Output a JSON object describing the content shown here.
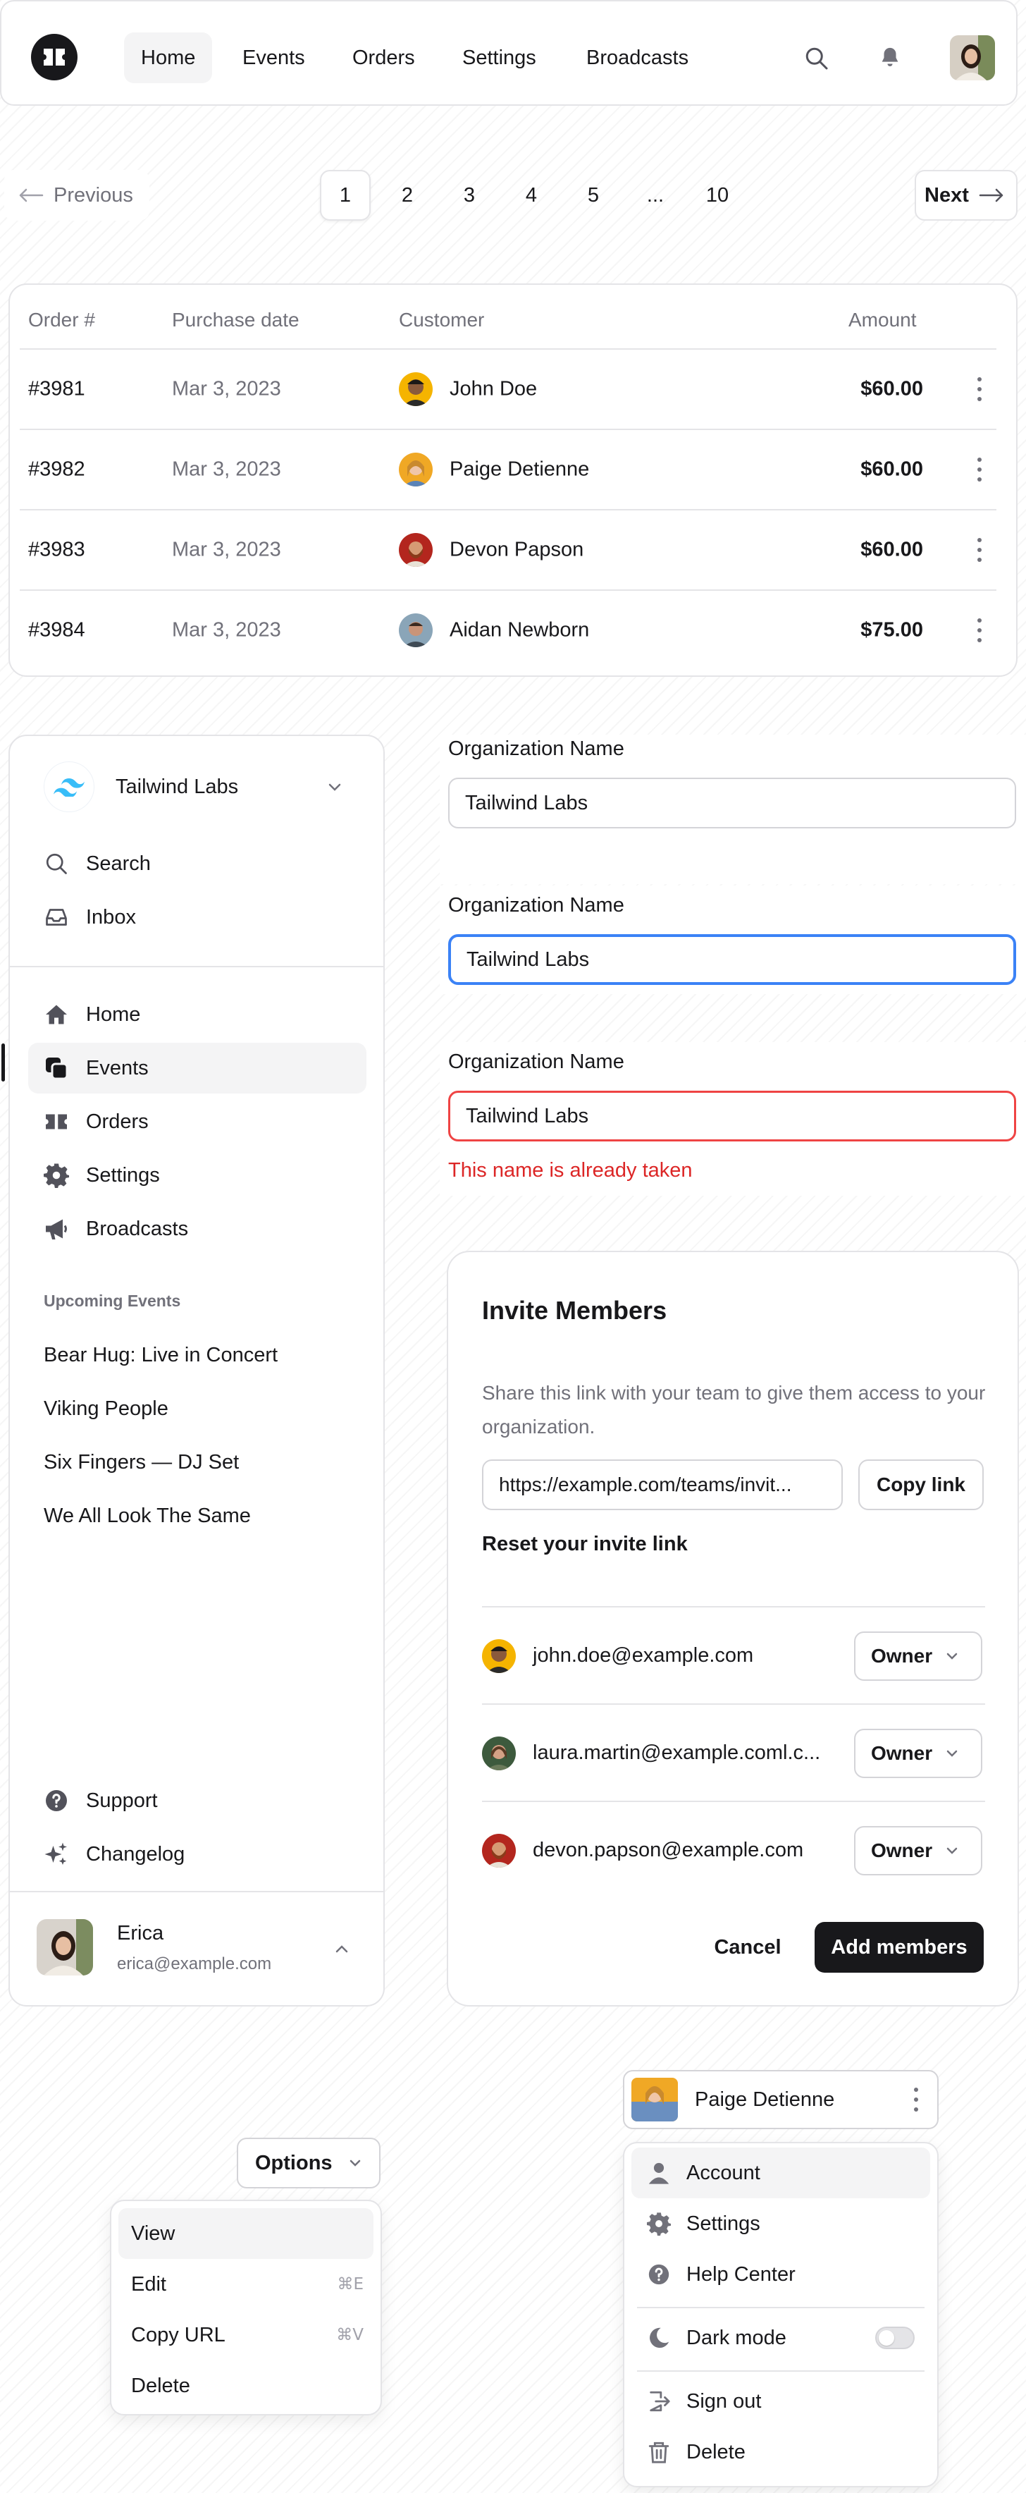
{
  "navbar": {
    "items": [
      {
        "label": "Home",
        "active": true
      },
      {
        "label": "Events"
      },
      {
        "label": "Orders"
      },
      {
        "label": "Settings"
      },
      {
        "label": "Broadcasts"
      }
    ]
  },
  "pagination": {
    "previous": "Previous",
    "next": "Next",
    "pages": [
      "1",
      "2",
      "3",
      "4",
      "5",
      "...",
      "10"
    ],
    "current_page": "1"
  },
  "orders_table": {
    "headers": [
      "Order #",
      "Purchase date",
      "Customer",
      "Amount"
    ],
    "rows": [
      {
        "order": "#3981",
        "date": "Mar 3, 2023",
        "customer": "John Doe",
        "amount": "$60.00"
      },
      {
        "order": "#3982",
        "date": "Mar 3, 2023",
        "customer": "Paige Detienne",
        "amount": "$60.00"
      },
      {
        "order": "#3983",
        "date": "Mar 3, 2023",
        "customer": "Devon Papson",
        "amount": "$60.00"
      },
      {
        "order": "#3984",
        "date": "Mar 3, 2023",
        "customer": "Aidan Newborn",
        "amount": "$75.00"
      }
    ]
  },
  "sidebar": {
    "team": "Tailwind Labs",
    "top_items": [
      {
        "label": "Search",
        "icon": "search-icon"
      },
      {
        "label": "Inbox",
        "icon": "inbox-icon"
      }
    ],
    "nav_items": [
      {
        "label": "Home",
        "icon": "home-icon"
      },
      {
        "label": "Events",
        "icon": "events-icon",
        "active": true
      },
      {
        "label": "Orders",
        "icon": "ticket-icon"
      },
      {
        "label": "Settings",
        "icon": "gear-icon"
      },
      {
        "label": "Broadcasts",
        "icon": "megaphone-icon"
      }
    ],
    "events_heading": "Upcoming Events",
    "events": [
      "Bear Hug: Live in Concert",
      "Viking People",
      "Six Fingers — DJ Set",
      "We All Look The Same"
    ],
    "bottom_items": [
      {
        "label": "Support",
        "icon": "help-icon"
      },
      {
        "label": "Changelog",
        "icon": "sparkles-icon"
      }
    ],
    "user": {
      "name": "Erica",
      "email": "erica@example.com"
    }
  },
  "forms": {
    "label": "Organization Name",
    "value": "Tailwind Labs",
    "error": "This name is already taken"
  },
  "invite": {
    "title": "Invite Members",
    "description": "Share this link with your team to give them access to your organization.",
    "link": "https://example.com/teams/invit...",
    "copy_label": "Copy link",
    "reset_label": "Reset your invite link",
    "members": [
      {
        "email": "john.doe@example.com",
        "role": "Owner"
      },
      {
        "email": "laura.martin@example.coml.c...",
        "role": "Owner"
      },
      {
        "email": "devon.papson@example.com",
        "role": "Owner"
      }
    ],
    "cancel_label": "Cancel",
    "submit_label": "Add members"
  },
  "options_menu": {
    "button_label": "Options",
    "items": [
      {
        "label": "View",
        "active": true
      },
      {
        "label": "Edit",
        "shortcut": "⌘E"
      },
      {
        "label": "Copy URL",
        "shortcut": "⌘V"
      },
      {
        "label": "Delete"
      }
    ]
  },
  "user_menu": {
    "name": "Paige Detienne",
    "items": [
      {
        "label": "Account",
        "icon": "user-icon",
        "active": true
      },
      {
        "label": "Settings",
        "icon": "gear-icon"
      },
      {
        "label": "Help Center",
        "icon": "help-icon"
      },
      {
        "label": "Dark mode",
        "icon": "moon-icon",
        "toggle_on": false
      },
      {
        "label": "Sign out",
        "icon": "sign-out-icon"
      },
      {
        "label": "Delete",
        "icon": "trash-icon"
      }
    ]
  },
  "colors": {
    "accent_focus": "#3b82f6",
    "error": "#dc2626",
    "primary_button": "#18181b"
  }
}
